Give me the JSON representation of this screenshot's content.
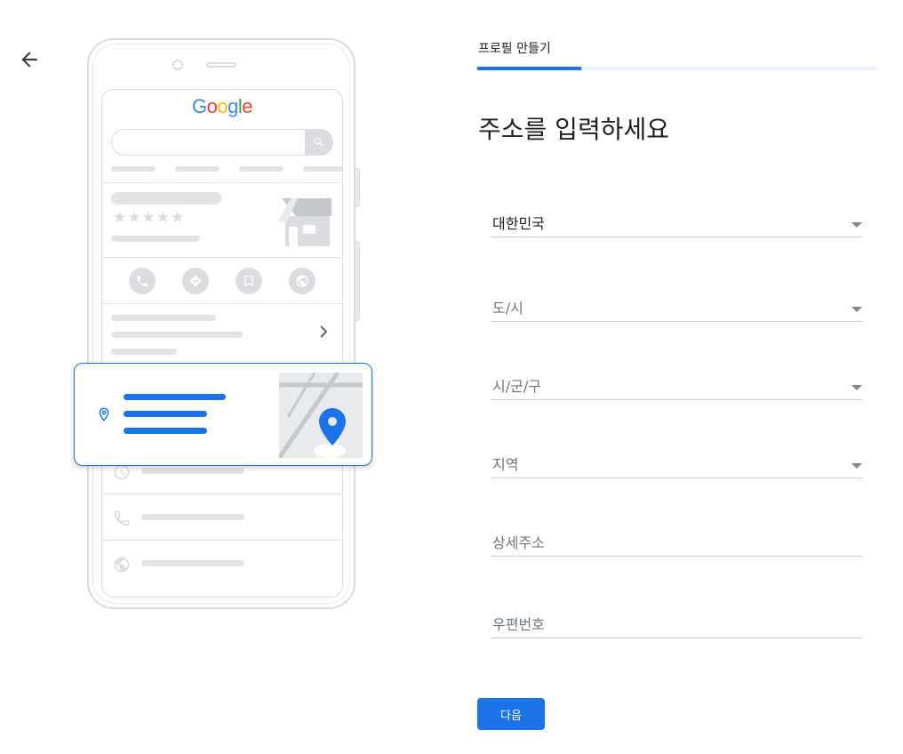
{
  "back": {
    "icon": "arrow-back-icon"
  },
  "header": {
    "step_label": "프로필 만들기",
    "progress_percent": 26
  },
  "title": "주소를 입력하세요",
  "form": {
    "country": {
      "value": "대한민국",
      "icon": "dropdown-caret-icon"
    },
    "province": {
      "placeholder": "도/시",
      "icon": "dropdown-caret-icon"
    },
    "city": {
      "placeholder": "시/군/구",
      "icon": "dropdown-caret-icon"
    },
    "area": {
      "placeholder": "지역",
      "icon": "dropdown-caret-icon"
    },
    "address_detail": {
      "placeholder": "상세주소"
    },
    "postal_code": {
      "placeholder": "우편번호"
    }
  },
  "next_button": {
    "label": "다음"
  },
  "illustration": {
    "logo": [
      "G",
      "o",
      "o",
      "g",
      "l",
      "e"
    ],
    "logo_colors": [
      "#4285F4",
      "#EA4335",
      "#FBBC05",
      "#4285F4",
      "#34A853",
      "#EA4335"
    ],
    "stars": "★★★★★",
    "accent_color": "#1a73e8"
  }
}
